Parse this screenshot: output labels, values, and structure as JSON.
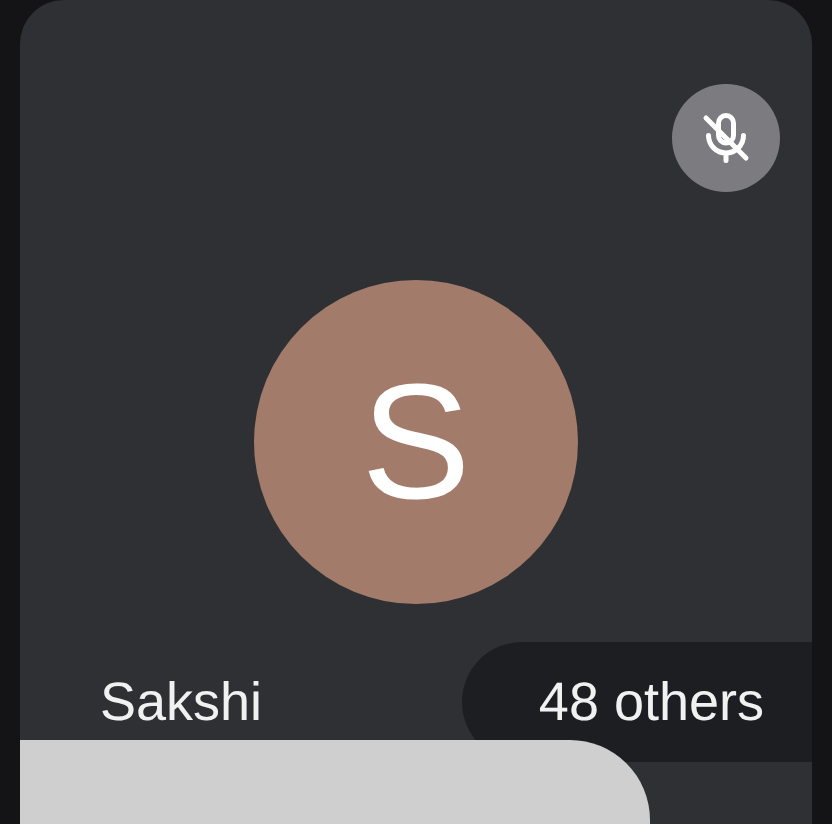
{
  "participant": {
    "initial": "S",
    "name": "Sakshi",
    "muted": true
  },
  "others_label": "48 others"
}
